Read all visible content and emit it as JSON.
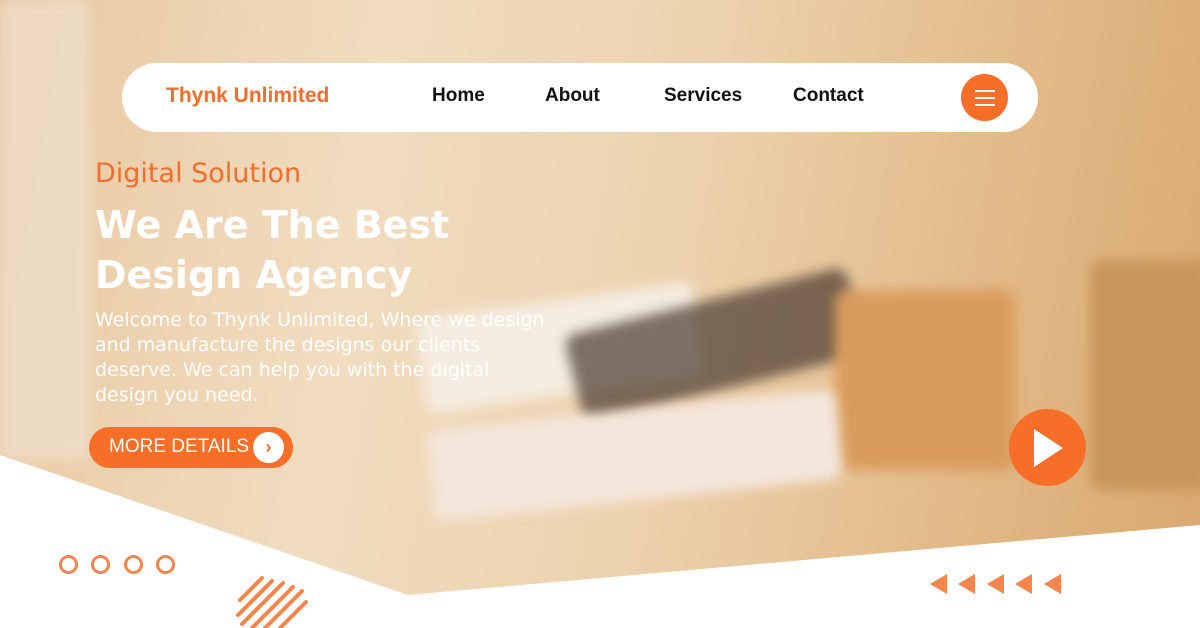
{
  "nav": {
    "logo": "Thynk Unlimited",
    "links": [
      "Home",
      "About",
      "Services",
      "Contact"
    ],
    "menu_icon": "hamburger-icon"
  },
  "hero": {
    "eyebrow": "Digital Solution",
    "title_line1": "We Are The Best",
    "title_line2": "Design Agency",
    "description": "Welcome to Thynk Unlimited, Where we design and manufacture the designs our clients deserve. We can help you with the digital design you need.",
    "cta_label": "MORE DETAILS",
    "cta_icon": "chevron-right-icon",
    "play_icon": "play-icon"
  },
  "colors": {
    "accent": "#f76e28",
    "text_on_image": "#ffffff"
  }
}
